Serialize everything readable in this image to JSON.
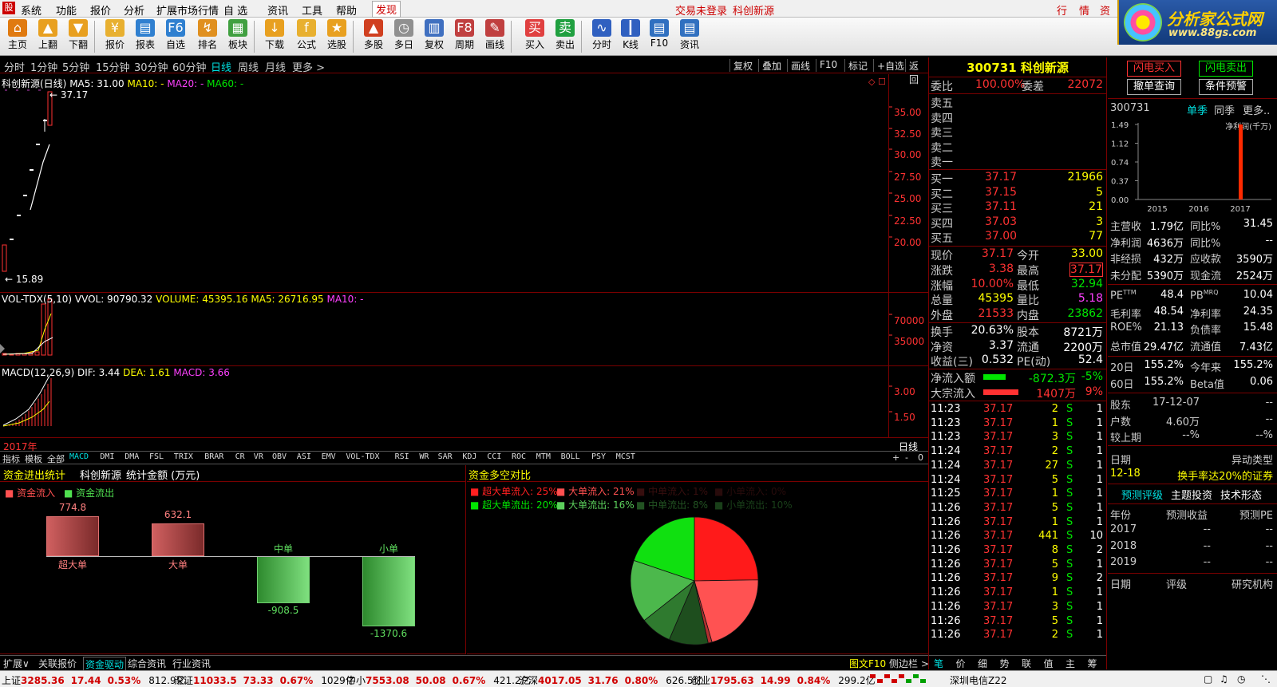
{
  "menu": {
    "items": [
      "系统",
      "功能",
      "报价",
      "分析",
      "扩展市场行情",
      "自 选",
      "资讯",
      "工具",
      "帮助",
      "发现"
    ],
    "login": "交易未登录",
    "stock_name": "科创新源",
    "right_tabs": [
      "行",
      "情",
      "资"
    ]
  },
  "toolbar": {
    "items": [
      "主页",
      "上翻",
      "下翻",
      "报价",
      "报表",
      "自选",
      "排名",
      "板块",
      "下载",
      "公式",
      "选股",
      "多股",
      "多日",
      "复权",
      "周期",
      "画线",
      "买入",
      "卖出",
      "分时",
      "K线",
      "F10",
      "资讯"
    ]
  },
  "brand": {
    "title": "分析家公式网",
    "url": "www.88gs.com"
  },
  "periods": {
    "items": [
      "分时",
      "1分钟",
      "5分钟",
      "15分钟",
      "30分钟",
      "60分钟",
      "日线",
      "周线",
      "月线",
      "更多 >"
    ],
    "right": [
      "复权",
      "叠加",
      "画线",
      "F10",
      "标记",
      "+自选",
      "返回"
    ]
  },
  "kline": {
    "title": "科创新源(日线)",
    "ma5": "MA5: 31.00",
    "ma10": "MA10: -",
    "ma20": "MA20: -",
    "ma60": "MA60: -",
    "high_label": "37.17",
    "low_label": "15.89",
    "yticks": [
      "35.00",
      "32.50",
      "30.00",
      "27.50",
      "25.00",
      "22.50",
      "20.00"
    ],
    "axis_label_year": "2017年",
    "axis_label_period": "日线"
  },
  "vol": {
    "title": "VOL-TDX(5,10)",
    "vvol": "VVOL: 90790.32",
    "volume": "VOLUME: 45395.16",
    "ma5": "MA5: 26716.95",
    "ma10": "MA10: -",
    "yticks": [
      "70000",
      "35000"
    ]
  },
  "macd": {
    "title": "MACD(12,26,9)",
    "dif": "DIF: 3.44",
    "dea": "DEA: 1.61",
    "macd": "MACD: 3.66",
    "yticks": [
      "3.00",
      "1.50"
    ]
  },
  "indicator_tabs": [
    "指标",
    "模板",
    "全部",
    "MACD",
    "DMI",
    "DMA",
    "FSL",
    "TRIX",
    "BRAR",
    "CR",
    "VR",
    "OBV",
    "ASI",
    "EMV",
    "VOL-TDX",
    "RSI",
    "WR",
    "SAR",
    "KDJ",
    "CCI",
    "ROC",
    "MTM",
    "BOLL",
    "PSY",
    "MCST"
  ],
  "fund": {
    "title": "资金进出统计",
    "stock": "科创新源",
    "unit": "统计金额 (万元)",
    "legend_in": "资金流入",
    "legend_out": "资金流出",
    "bars": [
      {
        "label": "超大单",
        "value": "774.8"
      },
      {
        "label": "大单",
        "value": "632.1"
      },
      {
        "label": "中单",
        "value": "-908.5"
      },
      {
        "label": "小单",
        "value": "-1370.6"
      }
    ],
    "bar_values": [
      774.8,
      632.1,
      -908.5,
      -1370.6
    ]
  },
  "compare": {
    "title": "资金多空对比",
    "legend": [
      {
        "text": "超大单流入: 25%",
        "color": "#ff2020"
      },
      {
        "text": "大单流入: 21%",
        "color": "#ff5050"
      },
      {
        "text": "中单流入:   1%",
        "color": "#7a2020"
      },
      {
        "text": "小单流入:   0%",
        "color": "#5a1a1a"
      },
      {
        "text": "超大单流出: 20%",
        "color": "#00e600"
      },
      {
        "text": "大单流出: 16%",
        "color": "#5cd05c"
      },
      {
        "text": "中单流出:   8%",
        "color": "#3a8a3a"
      },
      {
        "text": "小单流出: 10%",
        "color": "#2a6a2a"
      }
    ],
    "pie": [
      {
        "pct": 25,
        "color": "#ff1a1a"
      },
      {
        "pct": 21,
        "color": "#ff5252"
      },
      {
        "pct": 1,
        "color": "#b03030"
      },
      {
        "pct": 0,
        "color": "#5a1a1a"
      },
      {
        "pct": 10,
        "color": "#1e4e1e"
      },
      {
        "pct": 8,
        "color": "#2f7a2f"
      },
      {
        "pct": 16,
        "color": "#4cb84c"
      },
      {
        "pct": 20,
        "color": "#10e010"
      }
    ]
  },
  "bottom_tabs": [
    "扩展∨",
    "关联报价",
    "资金驱动",
    "综合资讯",
    "行业资讯"
  ],
  "bottom_right": [
    "图文F10",
    "侧边栏 >"
  ],
  "quote": {
    "code": "300731",
    "name": "科创新源",
    "wb_label": "委比",
    "wb": "100.00%",
    "wc_label": "委差",
    "wc": "22072",
    "sell": [
      "卖五",
      "卖四",
      "卖三",
      "卖二",
      "卖一"
    ],
    "buy": [
      {
        "l": "买一",
        "p": "37.17",
        "v": "21966"
      },
      {
        "l": "买二",
        "p": "37.15",
        "v": "5"
      },
      {
        "l": "买三",
        "p": "37.11",
        "v": "21"
      },
      {
        "l": "买四",
        "p": "37.03",
        "v": "3"
      },
      {
        "l": "买五",
        "p": "37.00",
        "v": "77"
      }
    ],
    "stats": [
      {
        "l1": "现价",
        "v1": "37.17",
        "l2": "今开",
        "v2": "33.00"
      },
      {
        "l1": "涨跌",
        "v1": "3.38",
        "l2": "最高",
        "v2": "37.17"
      },
      {
        "l1": "涨幅",
        "v1": "10.00%",
        "l2": "最低",
        "v2": "32.94"
      },
      {
        "l1": "总量",
        "v1": "45395",
        "l2": "量比",
        "v2": "5.18"
      },
      {
        "l1": "外盘",
        "v1": "21533",
        "l2": "内盘",
        "v2": "23862"
      }
    ],
    "stats2": [
      {
        "l1": "换手",
        "v1": "20.63%",
        "l2": "股本",
        "v2": "8721万"
      },
      {
        "l1": "净资",
        "v1": "3.37",
        "l2": "流通",
        "v2": "2200万"
      },
      {
        "l1": "收益(三)",
        "v1": "0.532",
        "l2": "PE(动)",
        "v2": "52.4"
      }
    ],
    "flow": [
      {
        "l": "净流入额",
        "v": "-872.3万",
        "p": "-5%"
      },
      {
        "l": "大宗流入",
        "v": "1407万",
        "p": "9%"
      }
    ],
    "ticks": [
      [
        "11:23",
        "37.17",
        "2",
        "S",
        "1"
      ],
      [
        "11:23",
        "37.17",
        "1",
        "S",
        "1"
      ],
      [
        "11:23",
        "37.17",
        "3",
        "S",
        "1"
      ],
      [
        "11:24",
        "37.17",
        "2",
        "S",
        "1"
      ],
      [
        "11:24",
        "37.17",
        "27",
        "S",
        "1"
      ],
      [
        "11:24",
        "37.17",
        "5",
        "S",
        "1"
      ],
      [
        "11:25",
        "37.17",
        "1",
        "S",
        "1"
      ],
      [
        "11:26",
        "37.17",
        "5",
        "S",
        "1"
      ],
      [
        "11:26",
        "37.17",
        "1",
        "S",
        "1"
      ],
      [
        "11:26",
        "37.17",
        "441",
        "S",
        "10"
      ],
      [
        "11:26",
        "37.17",
        "8",
        "S",
        "2"
      ],
      [
        "11:26",
        "37.17",
        "5",
        "S",
        "1"
      ],
      [
        "11:26",
        "37.17",
        "9",
        "S",
        "2"
      ],
      [
        "11:26",
        "37.17",
        "1",
        "S",
        "1"
      ],
      [
        "11:26",
        "37.17",
        "3",
        "S",
        "1"
      ],
      [
        "11:26",
        "37.17",
        "5",
        "S",
        "1"
      ],
      [
        "11:26",
        "37.17",
        "2",
        "S",
        "1"
      ]
    ],
    "tabs": [
      "笔",
      "价",
      "细",
      "势",
      "联",
      "值",
      "主",
      "筹"
    ]
  },
  "info": {
    "btn_buy": "闪电买入",
    "btn_sell": "闪电卖出",
    "btn_cancel": "撤单查询",
    "btn_cond": "条件预警",
    "code": "300731",
    "season": "单季",
    "same": "同季",
    "more": "更多..",
    "chart_label": "净利润(千万)",
    "yticks": [
      "1.49",
      "1.12",
      "0.74",
      "0.37",
      "0.00"
    ],
    "years": [
      "2015",
      "2016",
      "2017"
    ],
    "profit_values": [
      0,
      0,
      1.49
    ],
    "rows": [
      [
        "主营收",
        "1.79亿",
        "同比%",
        "31.45"
      ],
      [
        "净利润",
        "4636万",
        "同比%",
        "--"
      ],
      [
        "非经损",
        "432万",
        "应收款",
        "3590万"
      ],
      [
        "未分配",
        "5390万",
        "现金流",
        "2524万"
      ]
    ],
    "rows2": [
      [
        "PE",
        "48.4",
        "PB",
        "10.04"
      ],
      [
        "毛利率",
        "48.54",
        "净利率",
        "24.35"
      ],
      [
        "ROE%",
        "21.13",
        "负债率",
        "15.48"
      ],
      [
        "总市值",
        "29.47亿",
        "流通值",
        "7.43亿"
      ]
    ],
    "pe_sup": "TTM",
    "pb_sup": "MRQ",
    "rows3": [
      [
        "20日",
        "155.2%",
        "今年来",
        "155.2%"
      ],
      [
        "60日",
        "155.2%",
        "Beta值",
        "0.06"
      ]
    ],
    "rows4": [
      [
        "股东",
        "17-12-07",
        "--"
      ],
      [
        "户数",
        "4.60万",
        "--"
      ],
      [
        "较上期",
        "--%",
        "--%"
      ]
    ],
    "event_hdr": [
      "日期",
      "异动类型"
    ],
    "event": [
      "12-18",
      "换手率达20%的证券"
    ],
    "ftabs": [
      "预测评级",
      "主题投资",
      "技术形态"
    ],
    "fhdr": [
      "年份",
      "预测收益",
      "预测PE"
    ],
    "frows": [
      [
        "2017",
        "--",
        "--"
      ],
      [
        "2018",
        "--",
        "--"
      ],
      [
        "2019",
        "--",
        "--"
      ]
    ],
    "rhdr": [
      "日期",
      "评级",
      "研究机构"
    ]
  },
  "status": {
    "items": [
      {
        "n": "上证",
        "v": "3285.36",
        "c": "17.44",
        "p": "0.53%",
        "a": "812.9亿"
      },
      {
        "n": "深证",
        "v": "11033.5",
        "c": "73.33",
        "p": "0.67%",
        "a": "1029亿"
      },
      {
        "n": "中小",
        "v": "7553.08",
        "c": "50.08",
        "p": "0.67%",
        "a": "421.2亿"
      },
      {
        "n": "沪深",
        "v": "4017.05",
        "c": "31.76",
        "p": "0.80%",
        "a": "626.5亿"
      },
      {
        "n": "创业",
        "v": "1795.63",
        "c": "14.99",
        "p": "0.84%",
        "a": "299.2亿"
      }
    ],
    "broker": "深圳电信Z22"
  }
}
